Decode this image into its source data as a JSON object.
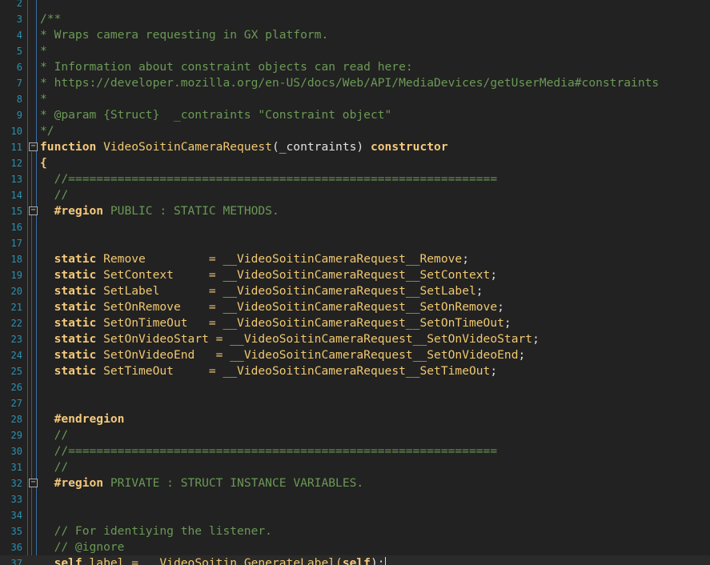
{
  "lines": [
    {
      "n": "2",
      "folder": false,
      "spans": []
    },
    {
      "n": "3",
      "folder": false,
      "spans": [
        {
          "t": "/**",
          "c": "c"
        }
      ]
    },
    {
      "n": "4",
      "folder": false,
      "spans": [
        {
          "t": "* Wraps camera requesting in GX platform.",
          "c": "c"
        }
      ]
    },
    {
      "n": "5",
      "folder": false,
      "spans": [
        {
          "t": "*",
          "c": "c"
        }
      ]
    },
    {
      "n": "6",
      "folder": false,
      "spans": [
        {
          "t": "* Information about constraint objects can read here:",
          "c": "c"
        }
      ]
    },
    {
      "n": "7",
      "folder": false,
      "spans": [
        {
          "t": "* https://developer.mozilla.org/en-US/docs/Web/API/MediaDevices/getUserMedia#constraints",
          "c": "c"
        }
      ]
    },
    {
      "n": "8",
      "folder": false,
      "spans": [
        {
          "t": "*",
          "c": "c"
        }
      ]
    },
    {
      "n": "9",
      "folder": false,
      "spans": [
        {
          "t": "* @param {Struct}  _contraints \"Constraint object\"",
          "c": "c"
        }
      ]
    },
    {
      "n": "10",
      "folder": false,
      "spans": [
        {
          "t": "*/",
          "c": "c"
        }
      ]
    },
    {
      "n": "11",
      "folder": true,
      "spans": [
        {
          "t": "function ",
          "c": "k"
        },
        {
          "t": "VideoSoitinCameraRequest",
          "c": "f"
        },
        {
          "t": "(_contraints) ",
          "c": "p"
        },
        {
          "t": "constructor",
          "c": "k"
        }
      ]
    },
    {
      "n": "12",
      "folder": false,
      "spans": [
        {
          "t": "{",
          "c": "k"
        }
      ]
    },
    {
      "n": "13",
      "folder": false,
      "spans": [
        {
          "t": "  ",
          "c": "dot"
        },
        {
          "t": "//=============================================================",
          "c": "c"
        }
      ]
    },
    {
      "n": "14",
      "folder": false,
      "spans": [
        {
          "t": "  ",
          "c": "dot"
        },
        {
          "t": "//",
          "c": "c"
        }
      ]
    },
    {
      "n": "15",
      "folder": true,
      "spans": [
        {
          "t": "  ",
          "c": "dot"
        },
        {
          "t": "#region",
          "c": "k"
        },
        {
          "t": " PUBLIC : STATIC METHODS.",
          "c": "c"
        }
      ]
    },
    {
      "n": "16",
      "folder": false,
      "spans": []
    },
    {
      "n": "17",
      "folder": false,
      "spans": [
        {
          "t": "  ",
          "c": "dot"
        }
      ]
    },
    {
      "n": "18",
      "folder": false,
      "spans": [
        {
          "t": "  ",
          "c": "dot"
        },
        {
          "t": "static ",
          "c": "k"
        },
        {
          "t": "Remove         = ",
          "c": "f"
        },
        {
          "t": "__VideoSoitinCameraRequest__Remove",
          "c": "f"
        },
        {
          "t": ";",
          "c": "p"
        }
      ]
    },
    {
      "n": "19",
      "folder": false,
      "spans": [
        {
          "t": "  ",
          "c": "dot"
        },
        {
          "t": "static ",
          "c": "k"
        },
        {
          "t": "SetContext     = ",
          "c": "f"
        },
        {
          "t": "__VideoSoitinCameraRequest__SetContext",
          "c": "f"
        },
        {
          "t": ";",
          "c": "p"
        }
      ]
    },
    {
      "n": "20",
      "folder": false,
      "spans": [
        {
          "t": "  ",
          "c": "dot"
        },
        {
          "t": "static ",
          "c": "k"
        },
        {
          "t": "SetLabel       = ",
          "c": "f"
        },
        {
          "t": "__VideoSoitinCameraRequest__SetLabel",
          "c": "f"
        },
        {
          "t": ";",
          "c": "p"
        }
      ]
    },
    {
      "n": "21",
      "folder": false,
      "spans": [
        {
          "t": "  ",
          "c": "dot"
        },
        {
          "t": "static ",
          "c": "k"
        },
        {
          "t": "SetOnRemove    = ",
          "c": "f"
        },
        {
          "t": "__VideoSoitinCameraRequest__SetOnRemove",
          "c": "f"
        },
        {
          "t": ";",
          "c": "p"
        }
      ]
    },
    {
      "n": "22",
      "folder": false,
      "spans": [
        {
          "t": "  ",
          "c": "dot"
        },
        {
          "t": "static ",
          "c": "k"
        },
        {
          "t": "SetOnTimeOut   = ",
          "c": "f"
        },
        {
          "t": "__VideoSoitinCameraRequest__SetOnTimeOut",
          "c": "f"
        },
        {
          "t": ";",
          "c": "p"
        }
      ]
    },
    {
      "n": "23",
      "folder": false,
      "spans": [
        {
          "t": "  ",
          "c": "dot"
        },
        {
          "t": "static ",
          "c": "k"
        },
        {
          "t": "SetOnVideoStart = ",
          "c": "f"
        },
        {
          "t": "__VideoSoitinCameraRequest__SetOnVideoStart",
          "c": "f"
        },
        {
          "t": ";",
          "c": "p"
        }
      ]
    },
    {
      "n": "24",
      "folder": false,
      "spans": [
        {
          "t": "  ",
          "c": "dot"
        },
        {
          "t": "static ",
          "c": "k"
        },
        {
          "t": "SetOnVideoEnd   = ",
          "c": "f"
        },
        {
          "t": "__VideoSoitinCameraRequest__SetOnVideoEnd",
          "c": "f"
        },
        {
          "t": ";",
          "c": "p"
        }
      ]
    },
    {
      "n": "25",
      "folder": false,
      "spans": [
        {
          "t": "  ",
          "c": "dot"
        },
        {
          "t": "static ",
          "c": "k"
        },
        {
          "t": "SetTimeOut     = ",
          "c": "f"
        },
        {
          "t": "__VideoSoitinCameraRequest__SetTimeOut",
          "c": "f"
        },
        {
          "t": ";",
          "c": "p"
        }
      ]
    },
    {
      "n": "26",
      "folder": false,
      "spans": []
    },
    {
      "n": "27",
      "folder": false,
      "spans": [
        {
          "t": "  ",
          "c": "dot"
        }
      ]
    },
    {
      "n": "28",
      "folder": false,
      "spans": [
        {
          "t": "  ",
          "c": "dot"
        },
        {
          "t": "#endregion",
          "c": "k"
        }
      ]
    },
    {
      "n": "29",
      "folder": false,
      "spans": [
        {
          "t": "  ",
          "c": "dot"
        },
        {
          "t": "//",
          "c": "c"
        }
      ]
    },
    {
      "n": "30",
      "folder": false,
      "spans": [
        {
          "t": "  ",
          "c": "dot"
        },
        {
          "t": "//=============================================================",
          "c": "c"
        }
      ]
    },
    {
      "n": "31",
      "folder": false,
      "spans": [
        {
          "t": "  ",
          "c": "dot"
        },
        {
          "t": "//",
          "c": "c"
        }
      ]
    },
    {
      "n": "32",
      "folder": true,
      "spans": [
        {
          "t": "  ",
          "c": "dot"
        },
        {
          "t": "#region",
          "c": "k"
        },
        {
          "t": " PRIVATE : STRUCT INSTANCE VARIABLES.",
          "c": "c"
        }
      ]
    },
    {
      "n": "33",
      "folder": false,
      "spans": [
        {
          "t": "  ",
          "c": "dot"
        }
      ]
    },
    {
      "n": "34",
      "folder": false,
      "spans": []
    },
    {
      "n": "35",
      "folder": false,
      "spans": [
        {
          "t": "  ",
          "c": "dot"
        },
        {
          "t": "// For identiying the listener.",
          "c": "c"
        }
      ]
    },
    {
      "n": "36",
      "folder": false,
      "spans": [
        {
          "t": "  ",
          "c": "dot"
        },
        {
          "t": "// @ignore",
          "c": "c"
        }
      ]
    },
    {
      "n": "37",
      "folder": false,
      "current": true,
      "spans": [
        {
          "t": "  ",
          "c": "dot"
        },
        {
          "t": "self",
          "c": "k"
        },
        {
          "t": ".label = __VideoSoitin_GenerateLabel(",
          "c": "f"
        },
        {
          "t": "self",
          "c": "k"
        },
        {
          "t": ");",
          "c": "p"
        }
      ]
    }
  ],
  "icons": {
    "fold": "minus-box-icon"
  },
  "colors": {
    "background": "#222222",
    "line_number": "#2b91af",
    "comment": "#6a9955",
    "keyword": "#f5c97a"
  }
}
